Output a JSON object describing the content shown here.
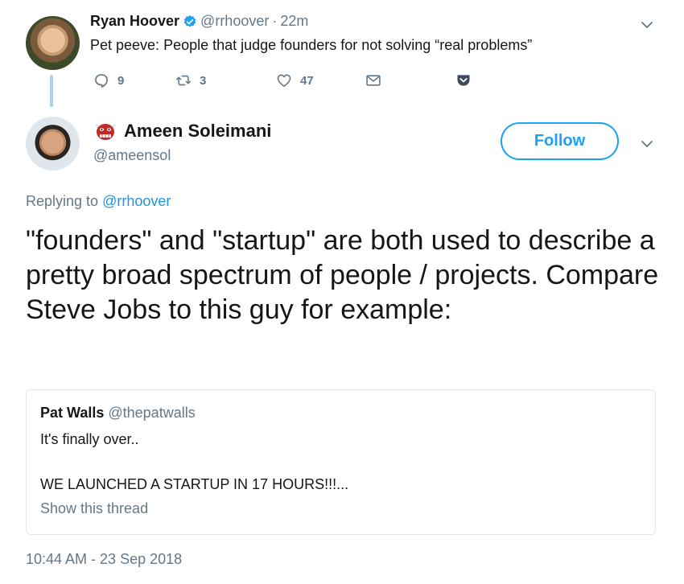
{
  "parent_tweet": {
    "author_name": "Ryan Hoover",
    "handle": "@rrhoover",
    "separator": "·",
    "time": "22m",
    "text": "Pet peeve: People that judge founders for not solving “real problems”",
    "replies": "9",
    "retweets": "3",
    "likes": "47"
  },
  "main_tweet": {
    "author_name": "Ameen Soleimani",
    "handle": "@ameensol",
    "follow_label": "Follow",
    "replying_prefix": "Replying to",
    "replying_to": "@rrhoover",
    "text": "\"founders\" and \"startup\" are both used to describe a pretty broad spectrum of people / projects. Compare Steve Jobs to this guy for example:",
    "timestamp": "10:44 AM - 23 Sep 2018"
  },
  "quoted_tweet": {
    "author_name": "Pat Walls",
    "handle": "@thepatwalls",
    "line1": "It's finally over..",
    "line2": "WE LAUNCHED A STARTUP IN 17 HOURS!!!...",
    "show_thread": "Show this thread"
  },
  "colors": {
    "accent": "#1da1f2",
    "link": "#1b95e0",
    "muted": "#657786",
    "text": "#14171a",
    "thread_line": "#a8d3ec",
    "pocket": "#3a4a5a"
  },
  "icons": [
    "verified-icon",
    "reply-icon",
    "retweet-icon",
    "like-icon",
    "dm-icon",
    "pocket-icon",
    "chevron-down-icon",
    "ogre-emoji-icon"
  ]
}
